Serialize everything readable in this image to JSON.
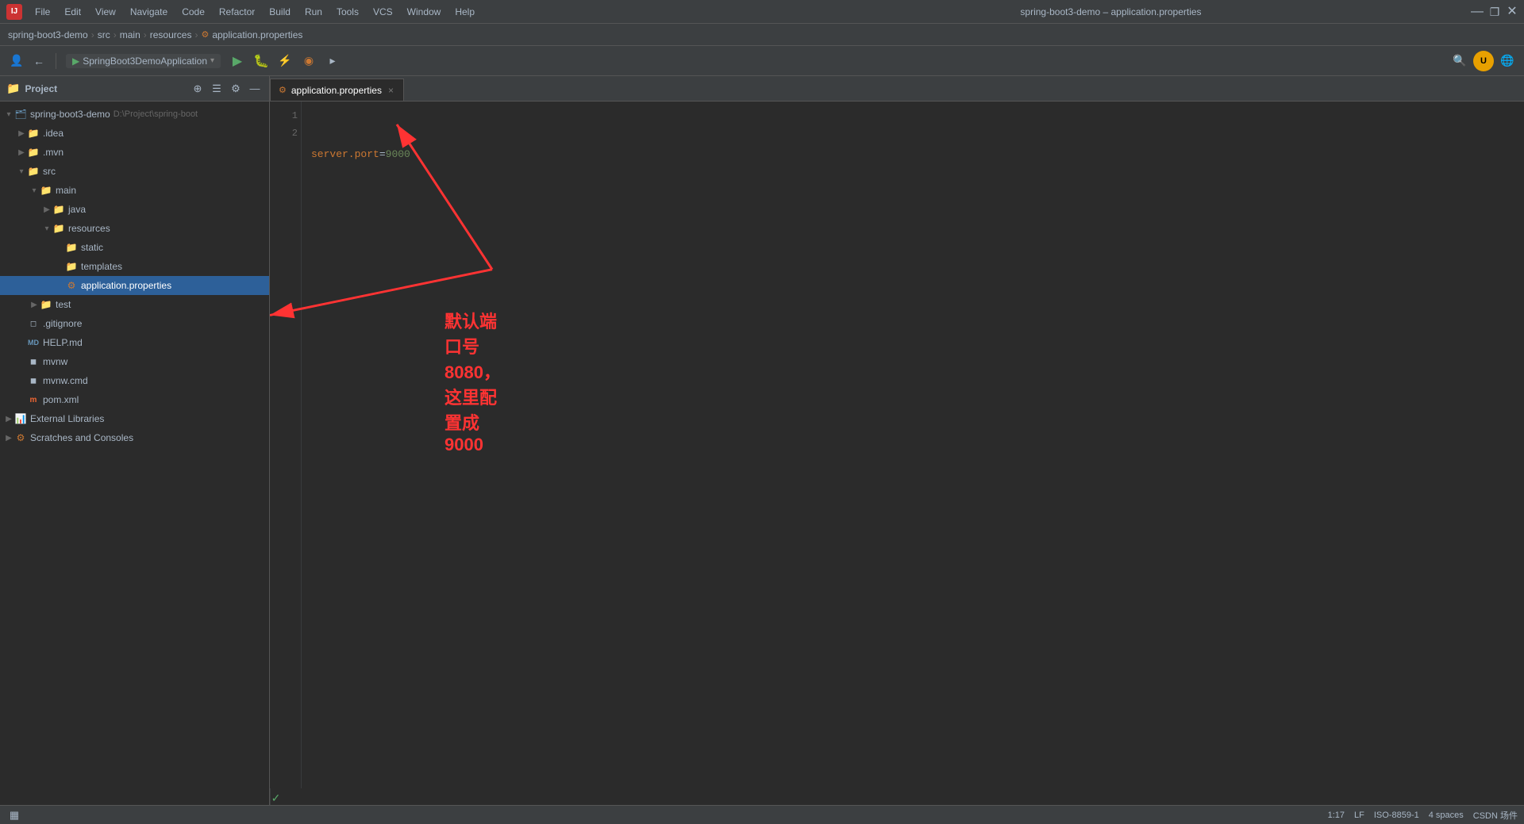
{
  "titleBar": {
    "logo": "IJ",
    "menu": [
      "File",
      "Edit",
      "View",
      "Navigate",
      "Code",
      "Refactor",
      "Build",
      "Run",
      "Tools",
      "VCS",
      "Window",
      "Help"
    ],
    "title": "spring-boot3-demo – application.properties",
    "minimize": "—",
    "maximize": "❐",
    "close": "✕"
  },
  "breadcrumb": {
    "parts": [
      "spring-boot3-demo",
      "src",
      "main",
      "resources",
      "application.properties"
    ]
  },
  "toolbar": {
    "runConfig": "SpringBoot3DemoApplication"
  },
  "sidebar": {
    "title": "Project",
    "tree": [
      {
        "id": "root",
        "label": "spring-boot3-demo",
        "sublabel": "D:\\Project\\spring-boot",
        "indent": 0,
        "expanded": true,
        "type": "project"
      },
      {
        "id": "idea",
        "label": ".idea",
        "indent": 1,
        "expanded": false,
        "type": "folder"
      },
      {
        "id": "mvn",
        "label": ".mvn",
        "indent": 1,
        "expanded": false,
        "type": "folder"
      },
      {
        "id": "src",
        "label": "src",
        "indent": 1,
        "expanded": true,
        "type": "folder"
      },
      {
        "id": "main",
        "label": "main",
        "indent": 2,
        "expanded": true,
        "type": "folder"
      },
      {
        "id": "java",
        "label": "java",
        "indent": 3,
        "expanded": false,
        "type": "folder"
      },
      {
        "id": "resources",
        "label": "resources",
        "indent": 3,
        "expanded": true,
        "type": "folder"
      },
      {
        "id": "static",
        "label": "static",
        "indent": 4,
        "expanded": false,
        "type": "folder"
      },
      {
        "id": "templates",
        "label": "templates",
        "indent": 4,
        "expanded": false,
        "type": "folder"
      },
      {
        "id": "appprops",
        "label": "application.properties",
        "indent": 4,
        "expanded": false,
        "type": "props",
        "selected": true
      },
      {
        "id": "test",
        "label": "test",
        "indent": 2,
        "expanded": false,
        "type": "folder"
      },
      {
        "id": "gitignore",
        "label": ".gitignore",
        "indent": 1,
        "expanded": false,
        "type": "file-git"
      },
      {
        "id": "helpmd",
        "label": "HELP.md",
        "indent": 1,
        "expanded": false,
        "type": "file-md"
      },
      {
        "id": "mvnw",
        "label": "mvnw",
        "indent": 1,
        "expanded": false,
        "type": "file"
      },
      {
        "id": "mvnwcmd",
        "label": "mvnw.cmd",
        "indent": 1,
        "expanded": false,
        "type": "file"
      },
      {
        "id": "pomxml",
        "label": "pom.xml",
        "indent": 1,
        "expanded": false,
        "type": "file-pom"
      },
      {
        "id": "extlibs",
        "label": "External Libraries",
        "indent": 0,
        "expanded": false,
        "type": "ext-libs"
      },
      {
        "id": "scratches",
        "label": "Scratches and Consoles",
        "indent": 0,
        "expanded": false,
        "type": "scratches"
      }
    ]
  },
  "editor": {
    "tab": {
      "icon": "⚙",
      "label": "application.properties",
      "close": "×"
    },
    "lines": [
      {
        "num": "1",
        "content": "server.port=9000"
      },
      {
        "num": "2",
        "content": ""
      }
    ],
    "annotation": {
      "text": "默认端口号8080，这里配置成9000",
      "color": "#ff3333"
    }
  },
  "statusBar": {
    "layout": "▦",
    "position": "1:17",
    "lineEnding": "LF",
    "encoding": "ISO-8859-1",
    "indent": "4 spaces",
    "csdn": "CSDN 场件"
  }
}
